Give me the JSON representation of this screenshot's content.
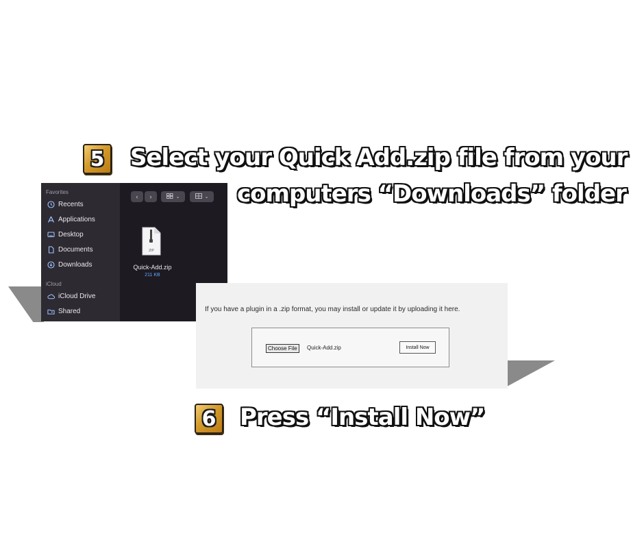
{
  "step5": {
    "number": "5",
    "line1": "Select your Quick Add.zip file from your",
    "line2": "computers “Downloads” folder"
  },
  "step6": {
    "number": "6",
    "text": "Press “Install Now”"
  },
  "finder": {
    "favorites_label": "Favorites",
    "icloud_label": "iCloud",
    "favorites": [
      {
        "label": "Recents",
        "icon": "clock-icon"
      },
      {
        "label": "Applications",
        "icon": "applications-icon"
      },
      {
        "label": "Desktop",
        "icon": "desktop-icon"
      },
      {
        "label": "Documents",
        "icon": "document-icon"
      },
      {
        "label": "Downloads",
        "icon": "download-icon"
      }
    ],
    "icloud": [
      {
        "label": "iCloud Drive",
        "icon": "cloud-icon"
      },
      {
        "label": "Shared",
        "icon": "shared-folder-icon"
      }
    ],
    "file": {
      "badge": "ZIP",
      "name": "Quick-Add.zip",
      "size": "211 KB"
    }
  },
  "upload": {
    "description": "If you have a plugin in a .zip format, you may install or update it by uploading it here.",
    "choose_label": "Choose File",
    "file_name": "Quick-Add.zip",
    "install_label": "Install Now"
  },
  "colors": {
    "badge_gold": "#d39a2c",
    "finder_bg": "#1f1b24",
    "sidebar_bg": "#2d2a32",
    "file_size_blue": "#5aa9ff"
  }
}
